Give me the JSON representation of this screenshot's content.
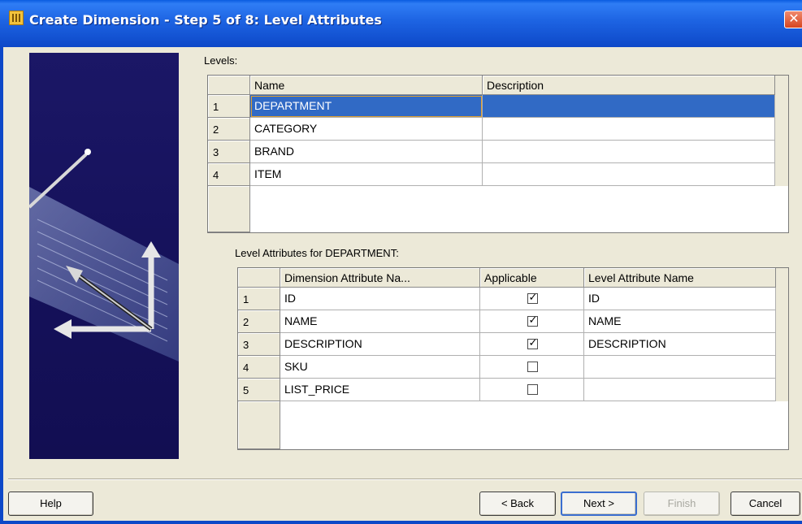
{
  "window": {
    "title": "Create Dimension - Step 5 of 8: Level Attributes",
    "close": "✕"
  },
  "levels": {
    "label": "Levels:",
    "headers": [
      "Name",
      "Description"
    ],
    "rows": [
      {
        "num": "1",
        "name": "DEPARTMENT",
        "desc": ""
      },
      {
        "num": "2",
        "name": "CATEGORY",
        "desc": ""
      },
      {
        "num": "3",
        "name": "BRAND",
        "desc": ""
      },
      {
        "num": "4",
        "name": "ITEM",
        "desc": ""
      }
    ]
  },
  "attributes": {
    "label": "Level Attributes for DEPARTMENT:",
    "headers": [
      "Dimension Attribute Na...",
      "Applicable",
      "Level Attribute Name"
    ],
    "rows": [
      {
        "num": "1",
        "dim": "ID",
        "applicable": true,
        "level": "ID"
      },
      {
        "num": "2",
        "dim": "NAME",
        "applicable": true,
        "level": "NAME"
      },
      {
        "num": "3",
        "dim": "DESCRIPTION",
        "applicable": true,
        "level": "DESCRIPTION"
      },
      {
        "num": "4",
        "dim": "SKU",
        "applicable": false,
        "level": ""
      },
      {
        "num": "5",
        "dim": "LIST_PRICE",
        "applicable": false,
        "level": ""
      }
    ]
  },
  "buttons": {
    "help": "Help",
    "back": "< Back",
    "next": "Next >",
    "finish": "Finish",
    "cancel": "Cancel"
  },
  "colors": {
    "titlebar": "#1d63e2",
    "selection": "#316ac5",
    "dialog_bg": "#ece9d8",
    "art_bg": "#1b1766"
  }
}
